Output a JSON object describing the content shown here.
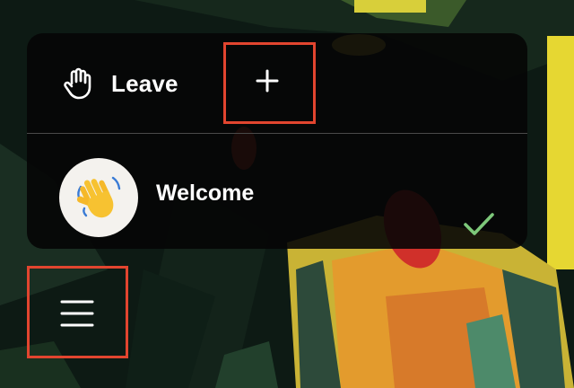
{
  "toolbar": {
    "leave_label": "Leave",
    "leave_icon": "hand-icon",
    "add_icon": "plus-icon"
  },
  "room": {
    "name": "Welcome",
    "avatar_icon": "waving-hand-icon",
    "selected": true,
    "status_icon": "checkmark-icon"
  },
  "menu": {
    "icon": "hamburger-menu-icon"
  },
  "colors": {
    "highlight": "#e2452f",
    "check": "#7dc87a",
    "panel": "#060606"
  }
}
